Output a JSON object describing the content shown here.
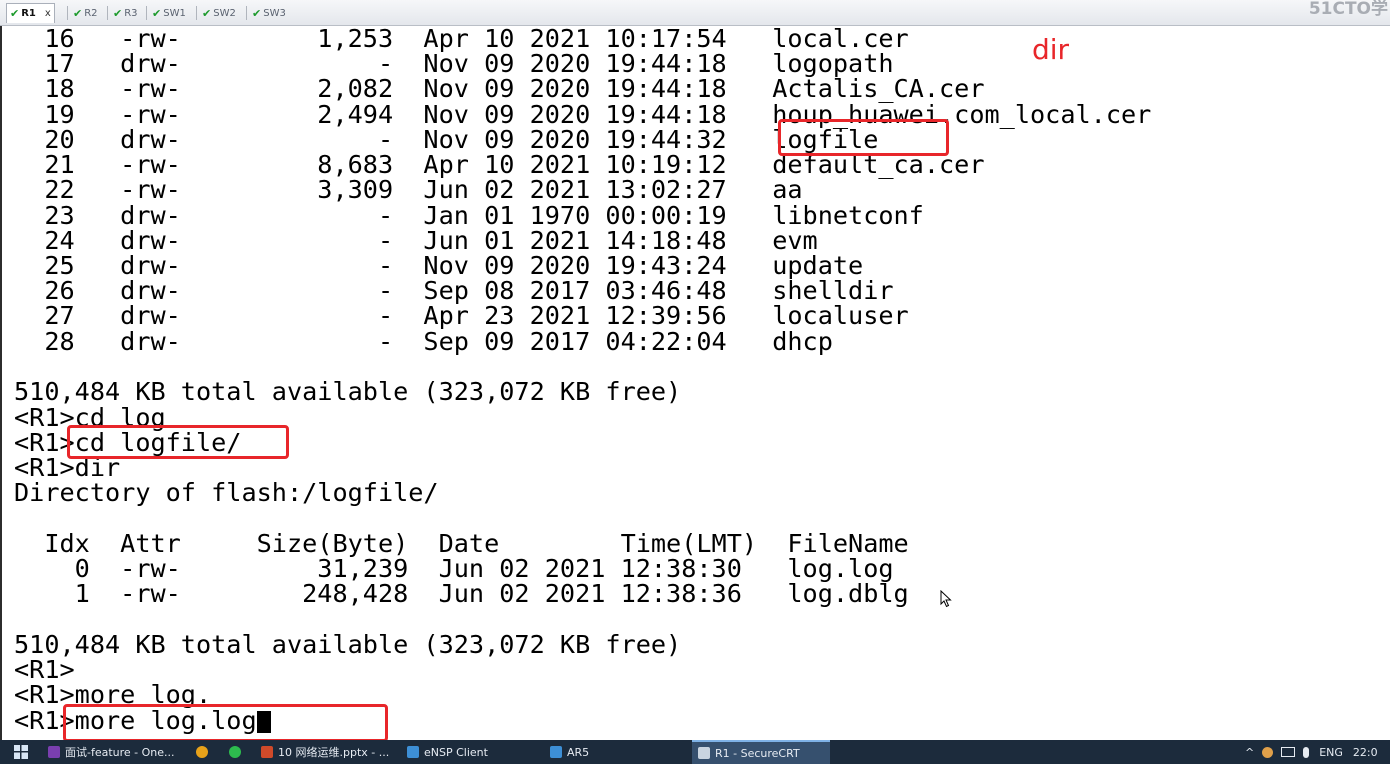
{
  "tabs": [
    {
      "label": "R1",
      "active": true,
      "close": "x"
    },
    {
      "label": "R2",
      "active": false
    },
    {
      "label": "R3",
      "active": false
    },
    {
      "label": "SW1",
      "active": false
    },
    {
      "label": "SW2",
      "active": false
    },
    {
      "label": "SW3",
      "active": false
    }
  ],
  "brand_text": "51CTO学",
  "terminal": {
    "lines": [
      "  16   -rw-         1,253  Apr 10 2021 10:17:54   local.cer",
      "  17   drw-             -  Nov 09 2020 19:44:18   logopath",
      "  18   -rw-         2,082  Nov 09 2020 19:44:18   Actalis_CA.cer",
      "  19   -rw-         2,494  Nov 09 2020 19:44:18   houp_huawei.com_local.cer",
      "  20   drw-             -  Nov 09 2020 19:44:32   logfile",
      "  21   -rw-         8,683  Apr 10 2021 10:19:12   default_ca.cer",
      "  22   -rw-         3,309  Jun 02 2021 13:02:27   aa",
      "  23   drw-             -  Jan 01 1970 00:00:19   libnetconf",
      "  24   drw-             -  Jun 01 2021 14:18:48   evm",
      "  25   drw-             -  Nov 09 2020 19:43:24   update",
      "  26   drw-             -  Sep 08 2017 03:46:48   shelldir",
      "  27   drw-             -  Apr 23 2021 12:39:56   localuser",
      "  28   drw-             -  Sep 09 2017 04:22:04   dhcp",
      "",
      "510,484 KB total available (323,072 KB free)",
      "<R1>cd log",
      "<R1>cd logfile/",
      "<R1>dir",
      "Directory of flash:/logfile/",
      "",
      "  Idx  Attr     Size(Byte)  Date        Time(LMT)  FileName",
      "    0  -rw-         31,239  Jun 02 2021 12:38:30   log.log",
      "    1  -rw-        248,428  Jun 02 2021 12:38:36   log.dblg",
      "",
      "510,484 KB total available (323,072 KB free)",
      "<R1>",
      "<R1>more log.",
      "<R1>more log.log"
    ],
    "annotation": "dir"
  },
  "taskbar": {
    "items": [
      {
        "label": "面试-feature - One...",
        "icon": "onenote-icon",
        "color": "#7a3fb0"
      },
      {
        "label": "",
        "icon": "chrome-icon",
        "color": "#e8a21a"
      },
      {
        "label": "",
        "icon": "wechat-icon",
        "color": "#2dbb4e"
      },
      {
        "label": "10 网络运维.pptx - ...",
        "icon": "powerpoint-icon",
        "color": "#d04a2a"
      },
      {
        "label": "eNSP Client",
        "icon": "ensp-icon",
        "color": "#3d8fd6"
      },
      {
        "label": "AR5",
        "icon": "ensp-router-icon",
        "color": "#3d8fd6"
      },
      {
        "label": "R1 - SecureCRT",
        "icon": "securecrt-icon",
        "color": "#c9d4e0"
      }
    ],
    "tray": {
      "caret": "^",
      "lang": "ENG",
      "time": "22:0"
    }
  }
}
